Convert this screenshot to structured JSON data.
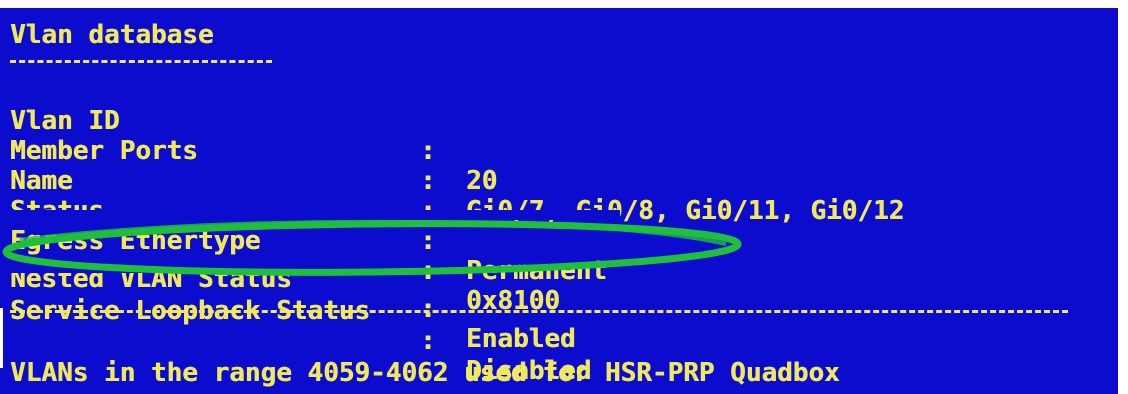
{
  "header": {
    "title": "Vlan database"
  },
  "rows": [
    {
      "label": "Vlan ID",
      "sep": ":",
      "value": "20"
    },
    {
      "label": "Member Ports",
      "sep": ":",
      "value": "Gi0/7, Gi0/8, Gi0/11, Gi0/12"
    },
    {
      "label": "Name",
      "sep": ":",
      "value": ""
    },
    {
      "label": "Status",
      "sep": ":",
      "value": "Permanent"
    },
    {
      "label": "Egress Ethertype",
      "sep": ":",
      "value": "0x8100"
    },
    {
      "label": "Nested VLAN Status",
      "sep": ":",
      "value": "Enabled"
    },
    {
      "label": "Service Loopback Status",
      "sep": ":",
      "value": "Disabled"
    }
  ],
  "footer": {
    "message": "VLANs in the range 4059-4062 used for HSR-PRP Quadbox"
  },
  "colors": {
    "terminal_bg": "#0c0ccf",
    "terminal_text": "#f0e95a",
    "highlight_oval": "#1fbf3a"
  }
}
